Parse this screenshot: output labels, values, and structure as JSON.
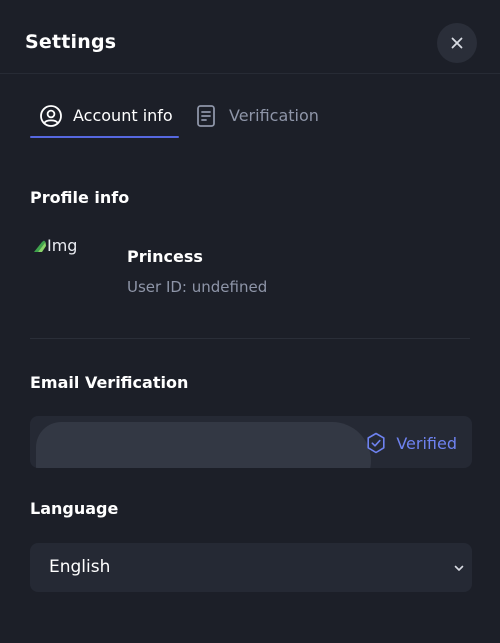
{
  "header": {
    "title": "Settings",
    "close_icon": "close-icon"
  },
  "tabs": [
    {
      "label": "Account info",
      "icon": "user-circle-icon",
      "active": true
    },
    {
      "label": "Verification",
      "icon": "document-icon",
      "active": false
    }
  ],
  "profile": {
    "section_title": "Profile info",
    "avatar_alt": "Img",
    "name": "Princess",
    "user_id": "User ID: undefined"
  },
  "email": {
    "section_title": "Email Verification",
    "status": "Verified",
    "status_icon": "verified-badge-icon"
  },
  "language": {
    "section_title": "Language",
    "selected": "English",
    "chevron_icon": "chevron-down-icon"
  },
  "colors": {
    "background": "#1c1f28",
    "accent": "#5668e0",
    "verified": "#6e82f0",
    "muted_text": "#8e95a8",
    "field_bg": "#252934"
  }
}
